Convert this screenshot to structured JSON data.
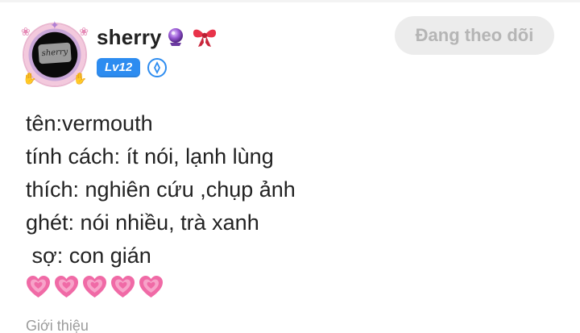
{
  "profile": {
    "username": "sherry",
    "username_emojis": [
      "crystal-ball-icon",
      "ribbon-icon"
    ],
    "avatar_text": "sherry",
    "level_badge": "Lv12",
    "medal_icon": "medal-icon"
  },
  "actions": {
    "follow_label": "Đang theo dõi"
  },
  "bio": {
    "lines": [
      "tên:vermouth",
      "tính cách: ít nói, lạnh lùng",
      "thích: nghiên cứu ,chụp ảnh",
      "ghét: nói nhiều, trà xanh",
      " sợ: con gián"
    ],
    "hearts_count": 5,
    "heart_icon": "growing-heart-icon"
  },
  "section": {
    "intro_label": "Giới thiệu"
  },
  "colors": {
    "level_badge_bg": "#2d8cf0",
    "follow_button_bg": "#ececec",
    "follow_button_text": "#b5b5b5",
    "heart_pink": "#f06aa6"
  }
}
